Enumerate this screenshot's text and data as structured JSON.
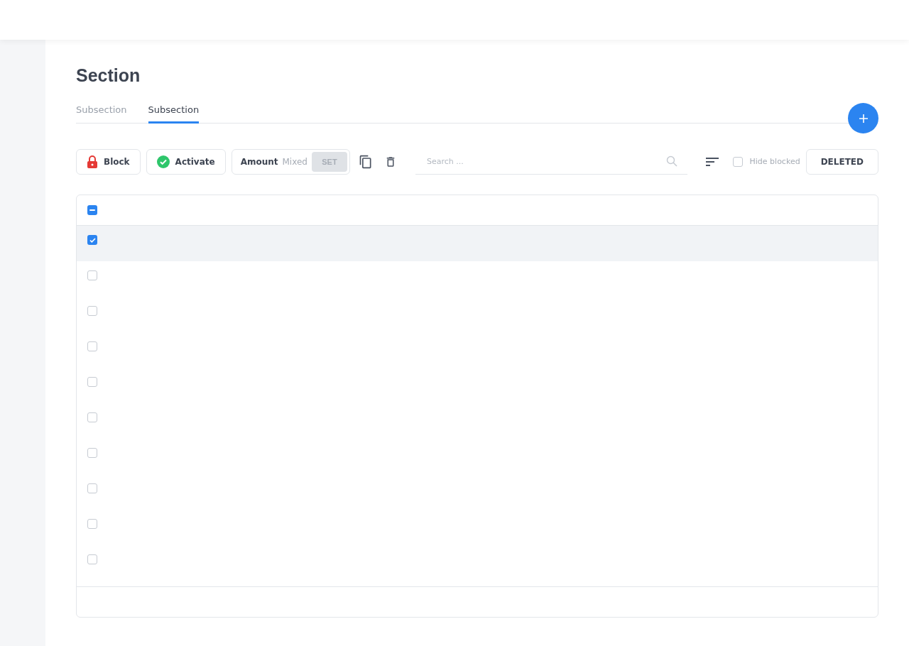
{
  "page": {
    "title": "Section"
  },
  "tabs": [
    {
      "label": "Subsection",
      "selected": false
    },
    {
      "label": "Subsection",
      "selected": true
    }
  ],
  "toolbar": {
    "block_button": "Block",
    "activate_button": "Activate",
    "amount": {
      "label": "Amount",
      "value": "Mixed",
      "set_button": "SET"
    },
    "search": {
      "placeholder": "Search ..."
    },
    "hide_blocked": {
      "label": "Hide blocked",
      "checked": false
    },
    "deleted_button": "DELETED"
  },
  "table": {
    "header_checkbox": {
      "checked": true,
      "indeterminate": true
    },
    "rows": [
      {
        "checked": true
      },
      {
        "checked": false
      },
      {
        "checked": false
      },
      {
        "checked": false
      },
      {
        "checked": false
      },
      {
        "checked": false
      },
      {
        "checked": false
      },
      {
        "checked": false
      },
      {
        "checked": false
      },
      {
        "checked": false
      }
    ]
  }
}
